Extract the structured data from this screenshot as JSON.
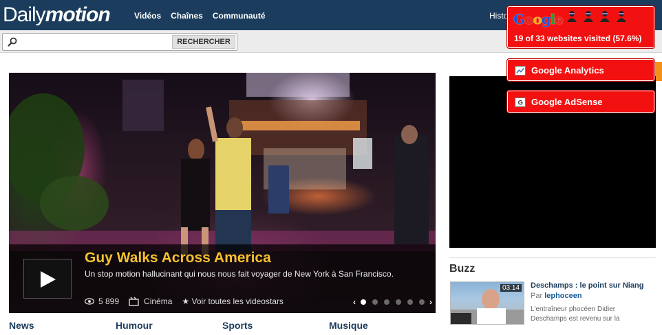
{
  "header": {
    "logo_daily": "Daily",
    "logo_motion": "motion",
    "nav": [
      "Vidéos",
      "Chaînes",
      "Communauté"
    ],
    "right_link": "Histo",
    "accent_color": "#1b3c5c"
  },
  "search": {
    "placeholder": "",
    "button_label": "RECHERCHER"
  },
  "feature": {
    "title": "Guy Walks Across America",
    "description": "Un stop motion hallucinant qui nous nous fait voyager de New York à San Francisco.",
    "views": "5 899",
    "category": "Cinéma",
    "videostars_link": "★ Voir toutes les videostars",
    "carousel_prev": "‹",
    "carousel_next": "›",
    "carousel_total": 6,
    "carousel_active": 1
  },
  "categories": [
    "News",
    "Humour",
    "Sports",
    "Musique"
  ],
  "buzz": {
    "title": "Buzz",
    "item": {
      "duration": "03:14",
      "headline": "Deschamps : le point sur Niang",
      "by_label": "Par",
      "author": "lephoceen",
      "snippet": "L'entraîneur phocéen Didier Deschamps est revenu sur la"
    }
  },
  "overlay": {
    "logo": "Google",
    "visited_text": "19 of 33 websites visited (57.6%)",
    "avatar_icon": "agent-silhouette-icon",
    "avatar_count": 4,
    "trackers": [
      {
        "label": "Google Analytics",
        "icon": "chart-icon"
      },
      {
        "label": "Google AdSense",
        "icon": "g-letter-icon"
      }
    ],
    "color": "#f21010"
  }
}
